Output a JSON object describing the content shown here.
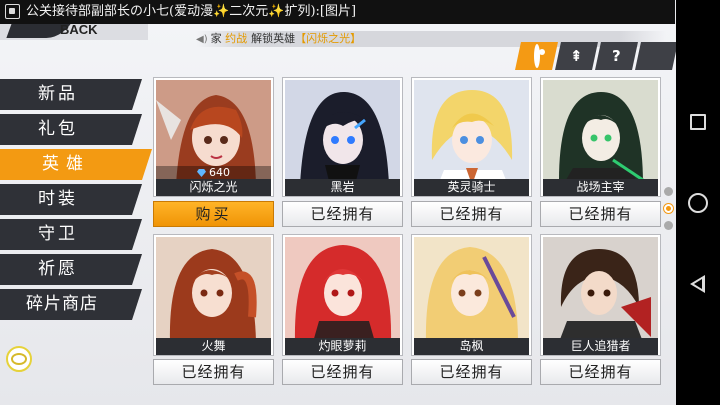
{
  "notification": {
    "text": "公关接待部副部长の小七(爱动漫✨二次元✨扩列):[图片]"
  },
  "header": {
    "back_label": "BACK",
    "announcement": {
      "sender": "家",
      "tag": "约战",
      "text": "解锁英雄",
      "hero": "【闪烁之光】"
    }
  },
  "tabs": [
    {
      "icon": "ring-icon",
      "glyph": ""
    },
    {
      "icon": "sword-icon",
      "glyph": "⇞"
    },
    {
      "icon": "question-icon",
      "glyph": "?"
    },
    {
      "icon": "shield-icon",
      "glyph": ""
    }
  ],
  "menu": {
    "items": [
      {
        "label": "新品"
      },
      {
        "label": "礼包"
      },
      {
        "label": "英雄"
      },
      {
        "label": "时装"
      },
      {
        "label": "守卫"
      },
      {
        "label": "祈愿"
      },
      {
        "label": "碎片商店"
      }
    ],
    "active_index": 2
  },
  "heroes": [
    {
      "name": "闪烁之光",
      "price": "640",
      "action": "购买"
    },
    {
      "name": "黑岩",
      "action": "已经拥有"
    },
    {
      "name": "英灵骑士",
      "action": "已经拥有"
    },
    {
      "name": "战场主宰",
      "action": "已经拥有"
    },
    {
      "name": "火舞",
      "action": "已经拥有"
    },
    {
      "name": "灼眼萝莉",
      "action": "已经拥有"
    },
    {
      "name": "岛枫",
      "action": "已经拥有"
    },
    {
      "name": "巨人追猎者",
      "action": "已经拥有"
    }
  ],
  "colors": {
    "accent": "#f49a14",
    "dark": "#2f3137",
    "gem": "#5fb6ff"
  },
  "pager": {
    "pages": 3,
    "current": 2
  }
}
